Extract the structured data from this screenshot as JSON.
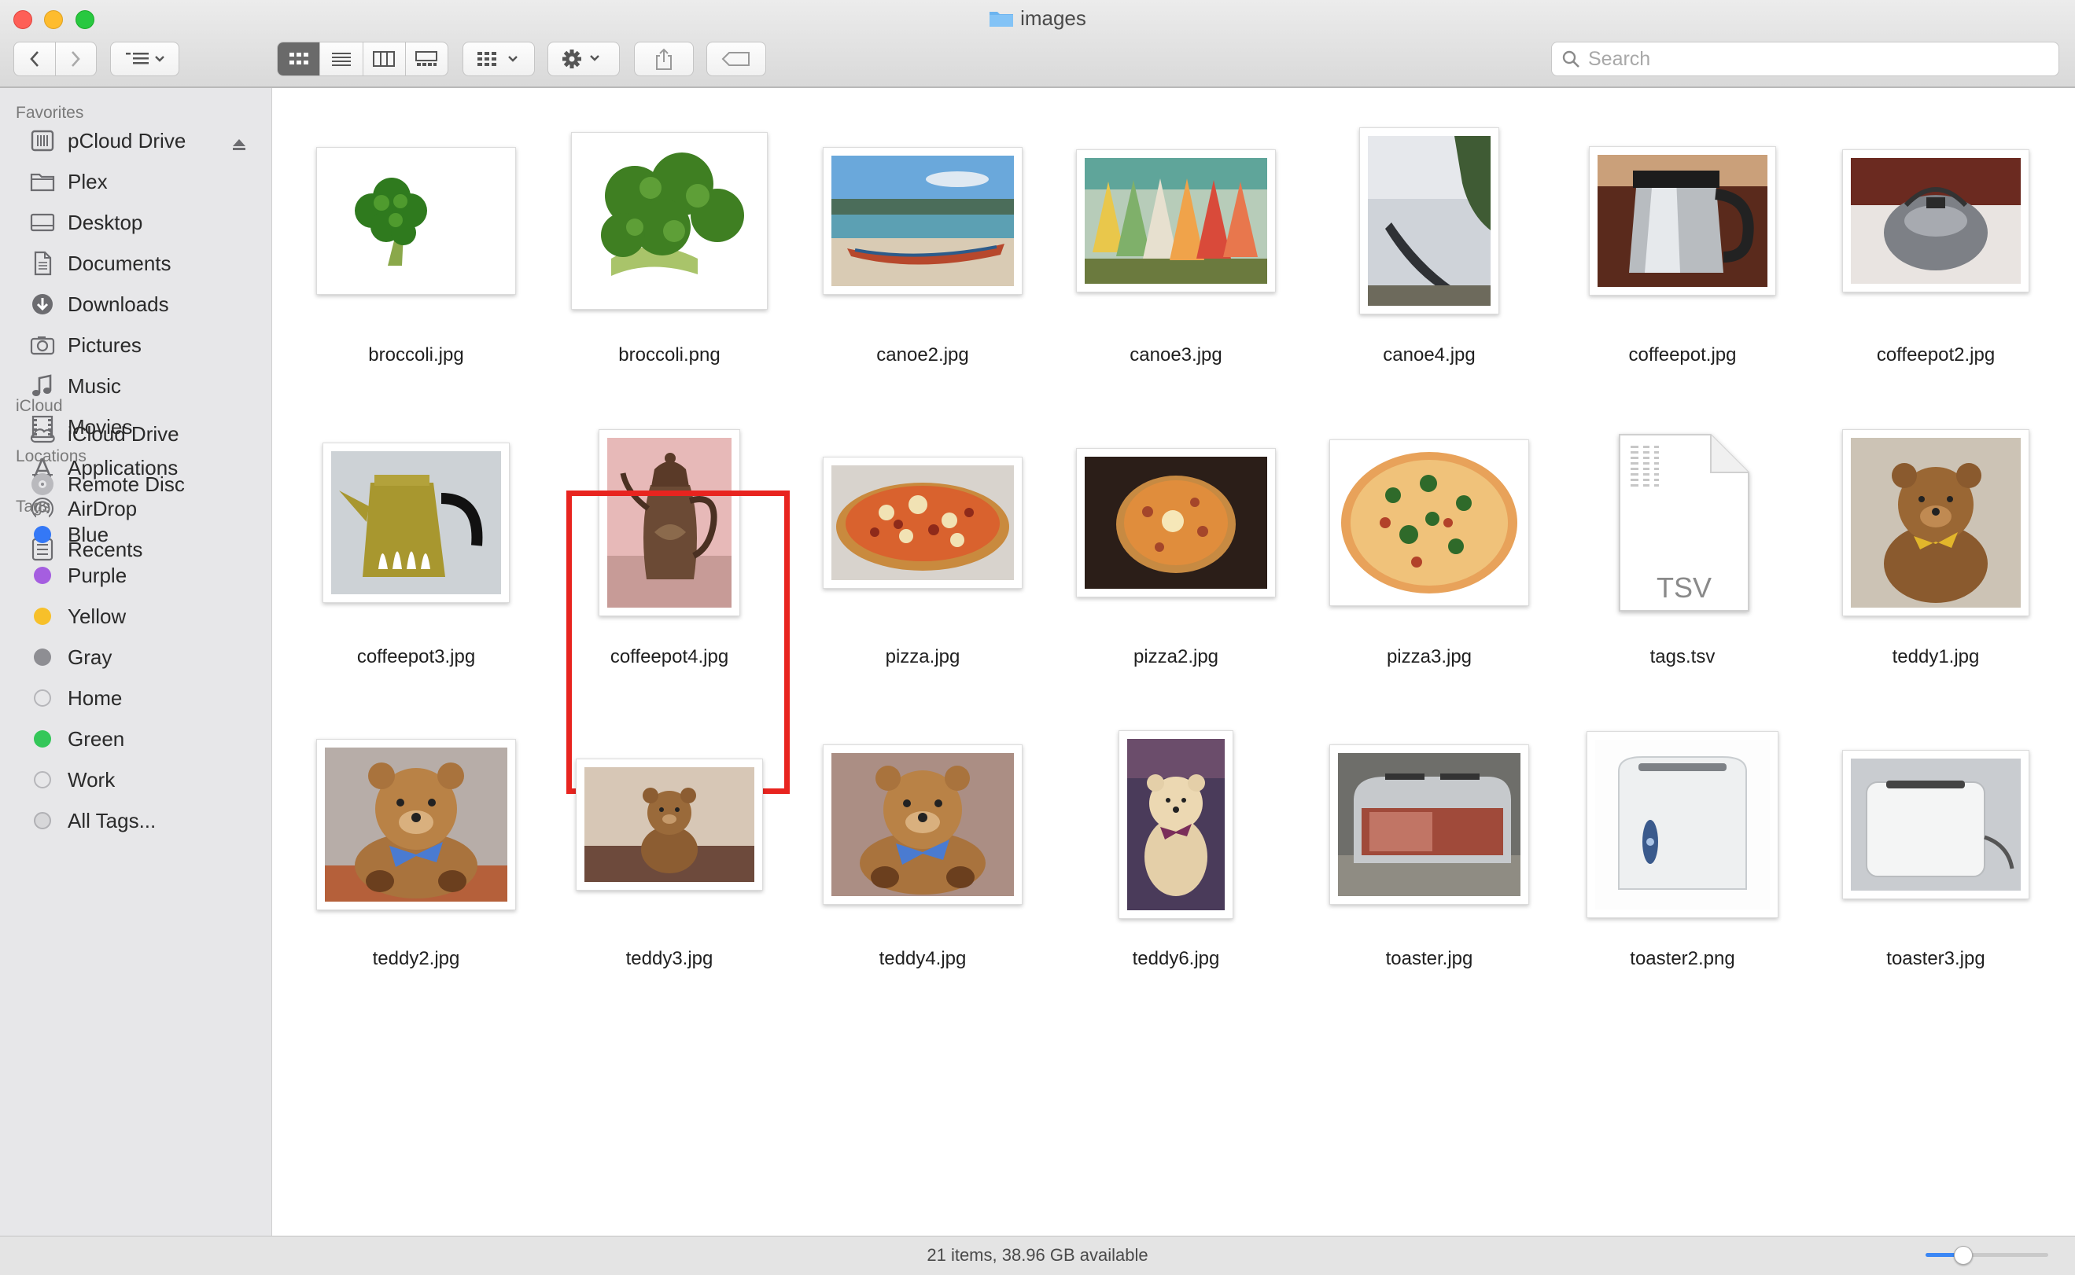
{
  "window": {
    "title": "images"
  },
  "toolbar": {
    "search_placeholder": "Search"
  },
  "sidebar": {
    "sections": [
      {
        "heading": "Favorites",
        "items": [
          {
            "label": "pCloud Drive",
            "icon": "pcloud-drive-icon"
          },
          {
            "label": "Plex",
            "icon": "folder-icon"
          },
          {
            "label": "Desktop",
            "icon": "desktop-icon"
          },
          {
            "label": "Documents",
            "icon": "documents-icon"
          },
          {
            "label": "Downloads",
            "icon": "downloads-icon"
          },
          {
            "label": "Pictures",
            "icon": "pictures-icon"
          },
          {
            "label": "Music",
            "icon": "music-icon"
          },
          {
            "label": "Movies",
            "icon": "movies-icon"
          },
          {
            "label": "Applications",
            "icon": "applications-icon"
          },
          {
            "label": "AirDrop",
            "icon": "airdrop-icon"
          },
          {
            "label": "Recents",
            "icon": "recents-icon"
          }
        ]
      },
      {
        "heading": "iCloud",
        "items": [
          {
            "label": "iCloud Drive",
            "icon": "cloud-icon"
          }
        ]
      },
      {
        "heading": "Locations",
        "items": [
          {
            "label": "Remote Disc",
            "icon": "disc-icon"
          }
        ]
      },
      {
        "heading": "Tags",
        "items": [
          {
            "label": "Blue",
            "color": "#3478f6"
          },
          {
            "label": "Purple",
            "color": "#a55ee0"
          },
          {
            "label": "Yellow",
            "color": "#f7c02a"
          },
          {
            "label": "Gray",
            "color": "#8e8e93"
          },
          {
            "label": "Home",
            "color": ""
          },
          {
            "label": "Green",
            "color": "#34c759"
          },
          {
            "label": "Work",
            "color": ""
          },
          {
            "label": "All Tags...",
            "color": "all"
          }
        ]
      }
    ]
  },
  "files": [
    {
      "name": "broccoli.jpg",
      "kind": "broccoli-white"
    },
    {
      "name": "broccoli.png",
      "kind": "broccoli-big"
    },
    {
      "name": "canoe2.jpg",
      "kind": "canoe-beach"
    },
    {
      "name": "canoe3.jpg",
      "kind": "canoe-row"
    },
    {
      "name": "canoe4.jpg",
      "kind": "canoe-lake"
    },
    {
      "name": "coffeepot.jpg",
      "kind": "coffeepot-steel"
    },
    {
      "name": "coffeepot2.jpg",
      "kind": "coffeepot-kettle"
    },
    {
      "name": "coffeepot3.jpg",
      "kind": "coffeepot-olive"
    },
    {
      "name": "coffeepot4.jpg",
      "kind": "coffeepot-ornate"
    },
    {
      "name": "pizza.jpg",
      "kind": "pizza-1"
    },
    {
      "name": "pizza2.jpg",
      "kind": "pizza-dark"
    },
    {
      "name": "pizza3.jpg",
      "kind": "pizza-spinach"
    },
    {
      "name": "tags.tsv",
      "kind": "tsv-doc",
      "doc_label": "TSV"
    },
    {
      "name": "teddy1.jpg",
      "kind": "teddy-1"
    },
    {
      "name": "teddy2.jpg",
      "kind": "teddy-bow"
    },
    {
      "name": "teddy3.jpg",
      "kind": "teddy-small"
    },
    {
      "name": "teddy4.jpg",
      "kind": "teddy-bow2"
    },
    {
      "name": "teddy6.jpg",
      "kind": "teddy-tall"
    },
    {
      "name": "toaster.jpg",
      "kind": "toaster-chrome"
    },
    {
      "name": "toaster2.png",
      "kind": "toaster-white"
    },
    {
      "name": "toaster3.jpg",
      "kind": "toaster-box"
    }
  ],
  "selected_file": "coffeepot4.jpg",
  "status": {
    "text": "21 items, 38.96 GB available"
  },
  "icon_size_slider": {
    "level": 0.3
  }
}
